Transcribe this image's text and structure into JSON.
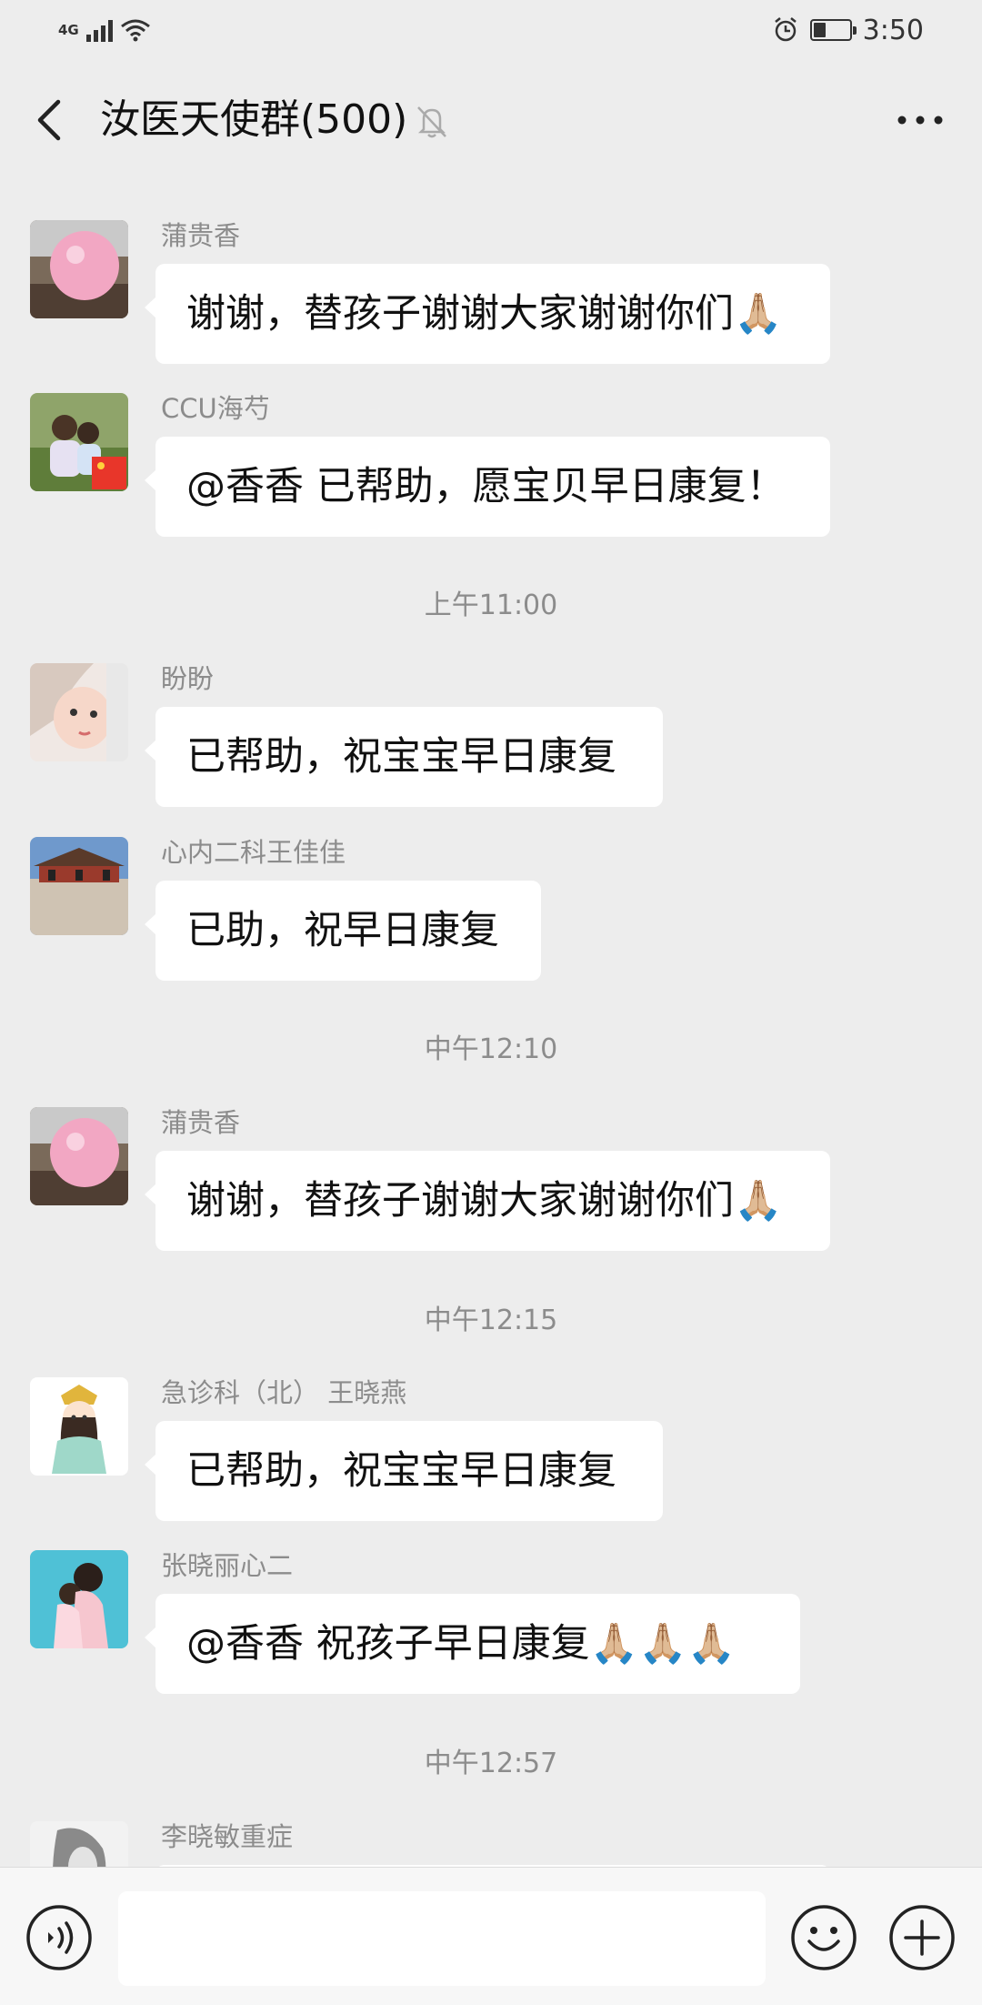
{
  "status_bar": {
    "network_label": "4G",
    "time": "3:50",
    "battery_level": 0.35
  },
  "header": {
    "title": "汝医天使群(500)",
    "icons": {
      "back": "chevron-left-icon",
      "mute": "bell-off-icon",
      "more": "more-dots-icon"
    }
  },
  "timeline": {
    "msg1": {
      "sender": "蒲贵香",
      "text": "谢谢，替孩子谢谢大家谢谢你们🙏🏼",
      "avatar": "pink-balloon"
    },
    "msg2": {
      "sender": "CCU海芍",
      "text": "@香香  已帮助，愿宝贝早日康复！",
      "avatar": "two-children-flag"
    },
    "time1": "上午11:00",
    "msg3": {
      "sender": "盼盼",
      "text": "已帮助，祝宝宝早日康复",
      "avatar": "child-portrait"
    },
    "msg4": {
      "sender": "心内二科王佳佳",
      "text": "已助，祝早日康复",
      "avatar": "palace"
    },
    "time2": "中午12:10",
    "msg5": {
      "sender": "蒲贵香",
      "text": "谢谢，替孩子谢谢大家谢谢你们🙏🏼",
      "avatar": "pink-balloon"
    },
    "time3": "中午12:15",
    "msg6": {
      "sender": "急诊科（北）  王晓燕",
      "text": "已帮助，祝宝宝早日康复",
      "avatar": "cartoon-princess"
    },
    "msg7": {
      "sender": "张晓丽心二",
      "text": "@香香  祝孩子早日康复🙏🏼🙏🏼🙏🏼",
      "avatar": "mother-child"
    },
    "time4": "中午12:57",
    "msg8": {
      "sender": "李晓敏重症",
      "text": "",
      "avatar": "sketch-portrait"
    }
  },
  "input_bar": {
    "text_value": "",
    "icons": {
      "voice": "voice-icon",
      "emoji": "emoji-icon",
      "plus": "plus-icon"
    }
  },
  "colors": {
    "background": "#ededed",
    "bubble": "#ffffff",
    "meta_text": "#8c8c8c",
    "input_bar": "#f7f7f7"
  }
}
